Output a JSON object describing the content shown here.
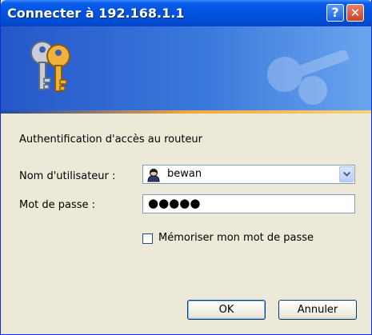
{
  "window": {
    "title": "Connecter à 192.168.1.1",
    "help_button": "?",
    "close_button": "✕"
  },
  "dialog": {
    "prompt": "Authentification d'accès au routeur",
    "username_label": "Nom d'utilisateur :",
    "username_value": "bewan",
    "password_label": "Mot de passe :",
    "password_value": "●●●●●",
    "remember_label": "Mémoriser mon mot de passe",
    "remember_checked": false,
    "ok_label": "OK",
    "cancel_label": "Annuler"
  },
  "icons": {
    "banner": "keys-icon",
    "user": "user-icon",
    "dropdown": "chevron-down-icon"
  },
  "colors": {
    "titlebar": "#0054e3",
    "banner_left": "#2557c8",
    "banner_right": "#6aa4ee",
    "face": "#ece9d8"
  }
}
